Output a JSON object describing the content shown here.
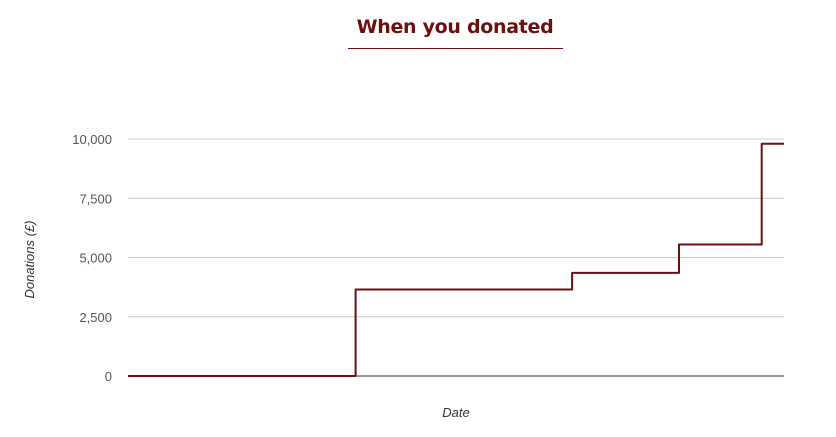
{
  "page": {
    "heading": "When you donated",
    "accent_color": "#6b0f0f"
  },
  "chart_data": {
    "type": "line",
    "style": "step",
    "title": "When you donated",
    "xlabel": "Date",
    "ylabel": "Donations (£)",
    "ylim": [
      0,
      10000
    ],
    "yticks": [
      0,
      2500,
      5000,
      7500,
      10000
    ],
    "ytick_labels": [
      "0",
      "2,500",
      "5,000",
      "7,500",
      "10,000"
    ],
    "xticks_shown": false,
    "grid": true,
    "legend": "none",
    "line_color": "#6b0f0f",
    "series": [
      {
        "x": [
          0,
          0.347,
          0.347,
          0.677,
          0.677,
          0.84,
          0.84,
          0.966,
          0.966,
          1.0
        ],
        "values": [
          0,
          0,
          3650,
          3650,
          4350,
          4350,
          5550,
          5550,
          9800,
          9800
        ]
      }
    ]
  }
}
